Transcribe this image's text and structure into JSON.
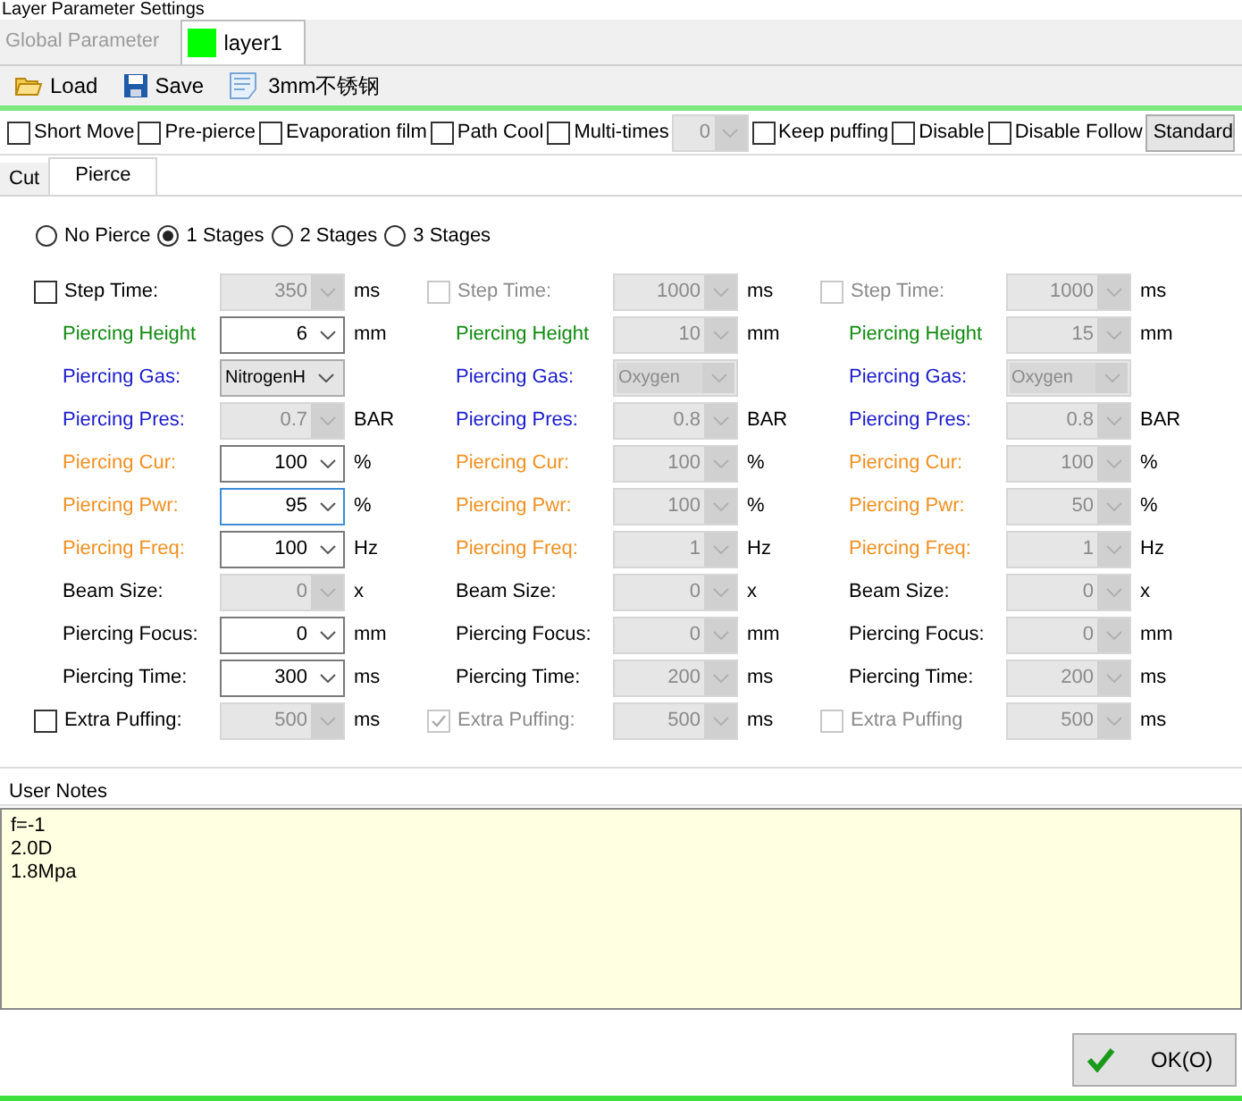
{
  "window": {
    "title": "Layer Parameter Settings"
  },
  "layer_tabs": [
    {
      "label": "Global Parameter",
      "selected": false
    },
    {
      "label": "layer1",
      "selected": true,
      "color": "#00ff00"
    }
  ],
  "toolbar": [
    {
      "kind": "load",
      "label": "Load"
    },
    {
      "kind": "save",
      "label": "Save"
    },
    {
      "kind": "material",
      "label": "3mm不锈钢"
    }
  ],
  "options": [
    {
      "kind": "check",
      "label": "Short Move",
      "checked": false
    },
    {
      "kind": "check",
      "label": "Pre-pierce",
      "checked": false
    },
    {
      "kind": "check",
      "label": "Evaporation film",
      "checked": false
    },
    {
      "kind": "check",
      "label": "Path Cool",
      "checked": false
    },
    {
      "kind": "check",
      "label": "Multi-times",
      "checked": false
    },
    {
      "kind": "spin",
      "value": "0",
      "disabled": true
    },
    {
      "kind": "check",
      "label": "Keep puffing",
      "checked": false
    },
    {
      "kind": "check",
      "label": "Disable",
      "checked": false
    },
    {
      "kind": "check",
      "label": "Disable Follow",
      "checked": false
    },
    {
      "kind": "select",
      "value": "Standard"
    }
  ],
  "tabs": [
    {
      "label": "Cut",
      "selected": false
    },
    {
      "label": "Pierce",
      "selected": true
    }
  ],
  "stages": [
    {
      "label": "No Pierce",
      "selected": false
    },
    {
      "label": "1 Stages",
      "selected": true
    },
    {
      "label": "2 Stages",
      "selected": false
    },
    {
      "label": "3 Stages",
      "selected": false
    }
  ],
  "columns": [
    {
      "rows": [
        {
          "kind": "check",
          "label": "Step Time:",
          "checked": false,
          "check_disabled": false,
          "value": "350",
          "disabled": true,
          "unit": "ms"
        },
        {
          "kind": "field",
          "label": "Piercing Height",
          "color": "#108a10",
          "value": "6",
          "disabled": false,
          "unit": "mm"
        },
        {
          "kind": "list",
          "label": "Piercing Gas:",
          "color": "#1a1acc",
          "value": "NitrogenH",
          "disabled": false
        },
        {
          "kind": "field",
          "label": "Piercing Pres:",
          "color": "#1a1acc",
          "value": "0.7",
          "disabled": true,
          "unit": "BAR"
        },
        {
          "kind": "field",
          "label": "Piercing Cur:",
          "color": "#f09020",
          "value": "100",
          "disabled": false,
          "unit": "%"
        },
        {
          "kind": "field",
          "label": "Piercing Pwr:",
          "color": "#f09020",
          "value": "95",
          "disabled": false,
          "focused": true,
          "unit": "%"
        },
        {
          "kind": "field",
          "label": "Piercing Freq:",
          "color": "#f09020",
          "value": "100",
          "disabled": false,
          "unit": "Hz"
        },
        {
          "kind": "field",
          "label": "Beam Size:",
          "color": "#000000",
          "value": "0",
          "disabled": true,
          "unit": "x"
        },
        {
          "kind": "field",
          "label": "Piercing Focus:",
          "color": "#000000",
          "value": "0",
          "disabled": false,
          "unit": "mm"
        },
        {
          "kind": "field",
          "label": "Piercing Time:",
          "color": "#000000",
          "value": "300",
          "disabled": false,
          "unit": "ms"
        },
        {
          "kind": "check",
          "label": "Extra Puffing:",
          "checked": false,
          "check_disabled": false,
          "value": "500",
          "disabled": true,
          "unit": "ms"
        }
      ]
    },
    {
      "rows": [
        {
          "kind": "check",
          "label": "Step Time:",
          "checked": false,
          "check_disabled": true,
          "value": "1000",
          "disabled": true,
          "unit": "ms"
        },
        {
          "kind": "field",
          "label": "Piercing Height",
          "color": "#108a10",
          "value": "10",
          "disabled": true,
          "unit": "mm"
        },
        {
          "kind": "list",
          "label": "Piercing Gas:",
          "color": "#1a1acc",
          "value": "Oxygen",
          "disabled": true
        },
        {
          "kind": "field",
          "label": "Piercing Pres:",
          "color": "#1a1acc",
          "value": "0.8",
          "disabled": true,
          "unit": "BAR"
        },
        {
          "kind": "field",
          "label": "Piercing Cur:",
          "color": "#f09020",
          "value": "100",
          "disabled": true,
          "unit": "%"
        },
        {
          "kind": "field",
          "label": "Piercing Pwr:",
          "color": "#f09020",
          "value": "100",
          "disabled": true,
          "unit": "%"
        },
        {
          "kind": "field",
          "label": "Piercing Freq:",
          "color": "#f09020",
          "value": "1",
          "disabled": true,
          "unit": "Hz"
        },
        {
          "kind": "field",
          "label": "Beam Size:",
          "color": "#000000",
          "value": "0",
          "disabled": true,
          "unit": "x"
        },
        {
          "kind": "field",
          "label": "Piercing Focus:",
          "color": "#000000",
          "value": "0",
          "disabled": true,
          "unit": "mm"
        },
        {
          "kind": "field",
          "label": "Piercing Time:",
          "color": "#000000",
          "value": "200",
          "disabled": true,
          "unit": "ms"
        },
        {
          "kind": "check",
          "label": "Extra Puffing:",
          "checked": true,
          "check_disabled": true,
          "value": "500",
          "disabled": true,
          "unit": "ms"
        }
      ]
    },
    {
      "rows": [
        {
          "kind": "check",
          "label": "Step Time:",
          "checked": false,
          "check_disabled": true,
          "value": "1000",
          "disabled": true,
          "unit": "ms"
        },
        {
          "kind": "field",
          "label": "Piercing Height",
          "color": "#108a10",
          "value": "15",
          "disabled": true,
          "unit": "mm"
        },
        {
          "kind": "list",
          "label": "Piercing Gas:",
          "color": "#1a1acc",
          "value": "Oxygen",
          "disabled": true
        },
        {
          "kind": "field",
          "label": "Piercing Pres:",
          "color": "#1a1acc",
          "value": "0.8",
          "disabled": true,
          "unit": "BAR"
        },
        {
          "kind": "field",
          "label": "Piercing Cur:",
          "color": "#f09020",
          "value": "100",
          "disabled": true,
          "unit": "%"
        },
        {
          "kind": "field",
          "label": "Piercing Pwr:",
          "color": "#f09020",
          "value": "50",
          "disabled": true,
          "unit": "%"
        },
        {
          "kind": "field",
          "label": "Piercing Freq:",
          "color": "#f09020",
          "value": "1",
          "disabled": true,
          "unit": "Hz"
        },
        {
          "kind": "field",
          "label": "Beam Size:",
          "color": "#000000",
          "value": "0",
          "disabled": true,
          "unit": "x"
        },
        {
          "kind": "field",
          "label": "Piercing Focus:",
          "color": "#000000",
          "value": "0",
          "disabled": true,
          "unit": "mm"
        },
        {
          "kind": "field",
          "label": "Piercing Time:",
          "color": "#000000",
          "value": "200",
          "disabled": true,
          "unit": "ms"
        },
        {
          "kind": "check",
          "label": "Extra Puffing",
          "checked": false,
          "check_disabled": true,
          "value": "500",
          "disabled": true,
          "unit": "ms"
        }
      ]
    }
  ],
  "user_notes": {
    "label": "User Notes",
    "lines": [
      "f=-1",
      "2.0D",
      "1.8Mpa"
    ]
  },
  "ok_button": {
    "label": "OK(O)"
  }
}
